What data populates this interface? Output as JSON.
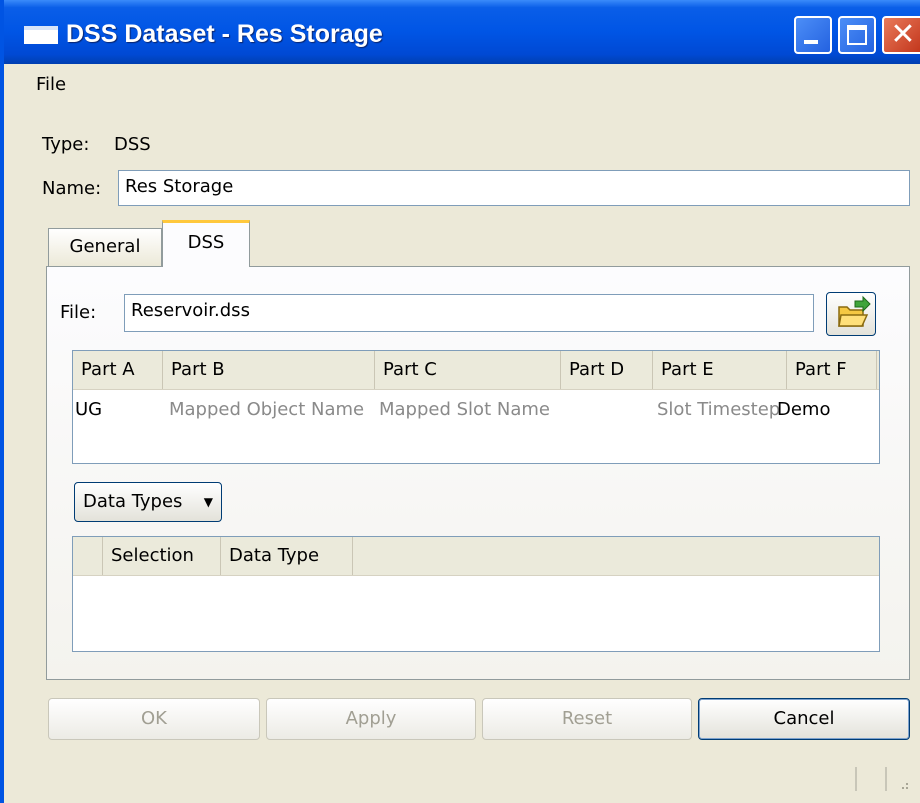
{
  "window": {
    "title": "DSS Dataset - Res Storage"
  },
  "menu": {
    "file": "File"
  },
  "form": {
    "type_label": "Type:",
    "type_value": "DSS",
    "name_label": "Name:",
    "name_value": "Res Storage"
  },
  "tabs": {
    "general": "General",
    "dss": "DSS",
    "selected": "DSS"
  },
  "dss": {
    "file_label": "File:",
    "file_value": "Reservoir.dss",
    "parts_headers": [
      "Part A",
      "Part B",
      "Part C",
      "Part D",
      "Part E",
      "Part F"
    ],
    "parts_row": [
      "UG",
      "Mapped Object Name",
      "Mapped Slot Name",
      "",
      "Slot Timestep",
      "Demo"
    ],
    "data_types_button": "Data Types",
    "types_headers": [
      "",
      "Selection",
      "Data Type"
    ]
  },
  "buttons": {
    "ok": "OK",
    "apply": "Apply",
    "reset": "Reset",
    "cancel": "Cancel"
  },
  "colors": {
    "titlebar": "#0055e5",
    "tab_accent": "#ffc83c",
    "disabled_text": "#a19f93"
  }
}
